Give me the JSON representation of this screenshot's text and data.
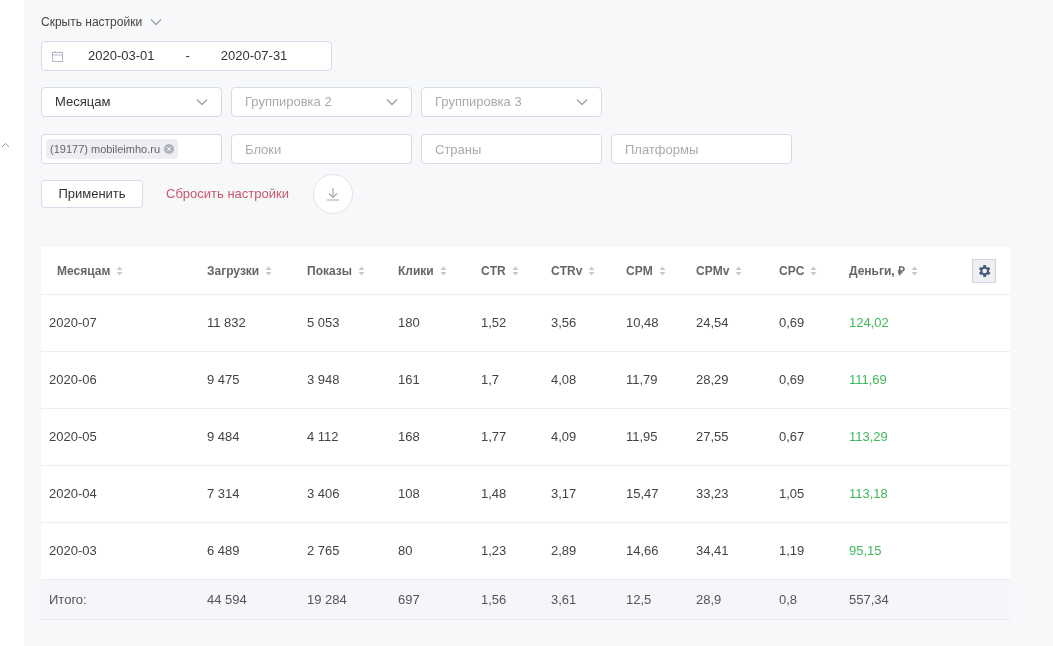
{
  "settings_toggle": "Скрыть настройки",
  "date_range": {
    "start": "2020-03-01",
    "separator": "-",
    "end": "2020-07-31"
  },
  "groupings": [
    {
      "value": "Месяцам"
    },
    {
      "placeholder": "Группировка 2"
    },
    {
      "placeholder": "Группировка 3"
    }
  ],
  "filters": [
    {
      "kind": "tags",
      "tags": [
        "(19177) mobileimho.ru"
      ]
    },
    {
      "kind": "input",
      "placeholder": "Блоки"
    },
    {
      "kind": "input",
      "placeholder": "Страны"
    },
    {
      "kind": "input",
      "placeholder": "Платформы"
    }
  ],
  "apply_button": "Применить",
  "reset_link": "Сбросить настройки",
  "table": {
    "columns": [
      "Месяцам",
      "Загрузки",
      "Показы",
      "Клики",
      "CTR",
      "CTRv",
      "CPM",
      "CPMv",
      "CPC",
      "Деньги, ₽"
    ],
    "rows": [
      {
        "cells": [
          "2020-07",
          "11 832",
          "5 053",
          "180",
          "1,52",
          "3,56",
          "10,48",
          "24,54",
          "0,69",
          "124,02"
        ]
      },
      {
        "cells": [
          "2020-06",
          "9 475",
          "3 948",
          "161",
          "1,7",
          "4,08",
          "11,79",
          "28,29",
          "0,69",
          "111,69"
        ]
      },
      {
        "cells": [
          "2020-05",
          "9 484",
          "4 112",
          "168",
          "1,77",
          "4,09",
          "11,95",
          "27,55",
          "0,67",
          "113,29"
        ]
      },
      {
        "cells": [
          "2020-04",
          "7 314",
          "3 406",
          "108",
          "1,48",
          "3,17",
          "15,47",
          "33,23",
          "1,05",
          "113,18"
        ]
      },
      {
        "cells": [
          "2020-03",
          "6 489",
          "2 765",
          "80",
          "1,23",
          "2,89",
          "14,66",
          "34,41",
          "1,19",
          "95,15"
        ]
      }
    ],
    "total": {
      "cells": [
        "Итого:",
        "44 594",
        "19 284",
        "697",
        "1,56",
        "3,61",
        "12,5",
        "28,9",
        "0,8",
        "557,34"
      ]
    }
  }
}
